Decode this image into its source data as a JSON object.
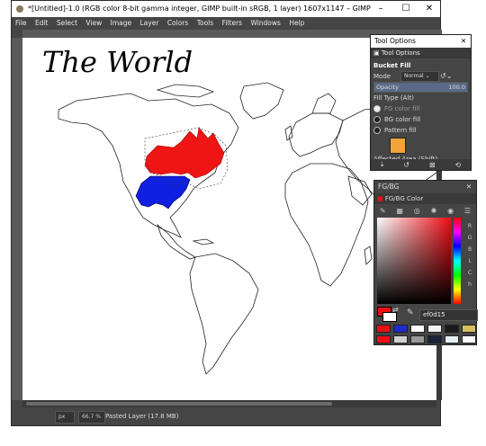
{
  "window": {
    "title": "*[Untitled]-1.0 (RGB color 8-bit gamma integer, GIMP built-in sRGB, 1 layer) 1607x1147 – GIMP",
    "controls": [
      "–",
      "☐",
      "✕"
    ]
  },
  "menu": [
    "File",
    "Edit",
    "Select",
    "View",
    "Image",
    "Layer",
    "Colors",
    "Tools",
    "Filters",
    "Windows",
    "Help"
  ],
  "canvas": {
    "heading": "The World",
    "fill_colors": {
      "canada": "#ef1515",
      "usa": "#1020e0",
      "outline": "#222222"
    }
  },
  "status": {
    "unit": "px",
    "zoom": "66.7 %",
    "layer_info": "Pasted Layer (17.8 MB)"
  },
  "tool_options": {
    "window_title": "Tool Options",
    "tab_label": "Tool Options",
    "tool_name": "Bucket Fill",
    "mode_label": "Mode",
    "mode_value": "Normal",
    "opacity_label": "Opacity",
    "opacity_value": "100.0",
    "fill_type_label": "Fill Type  (Alt)",
    "fill_options": [
      "FG color fill",
      "BG color fill",
      "Pattern fill"
    ],
    "selected_fill": 0,
    "affected_area_label": "Affected Area  (Shift)",
    "pattern_color": "#f2a43a"
  },
  "fgbg": {
    "window_title": "FG/BG",
    "tab_label": "FG/BG Color",
    "hex_value": "ef0d15",
    "fg_color": "#ef0d15",
    "bg_color": "#ffffff",
    "channels": [
      "R",
      "G",
      "B",
      "L",
      "C",
      "h"
    ],
    "history": [
      "#ef0d15",
      "#1d2bd0",
      "#ffffff",
      "#f2f2f2",
      "#1a1a1a",
      "#d4c060",
      "#ef0d15",
      "#d0d0d0",
      "#9a9a9a",
      "#18243a",
      "#e6f0f6",
      "#ffffff"
    ]
  }
}
